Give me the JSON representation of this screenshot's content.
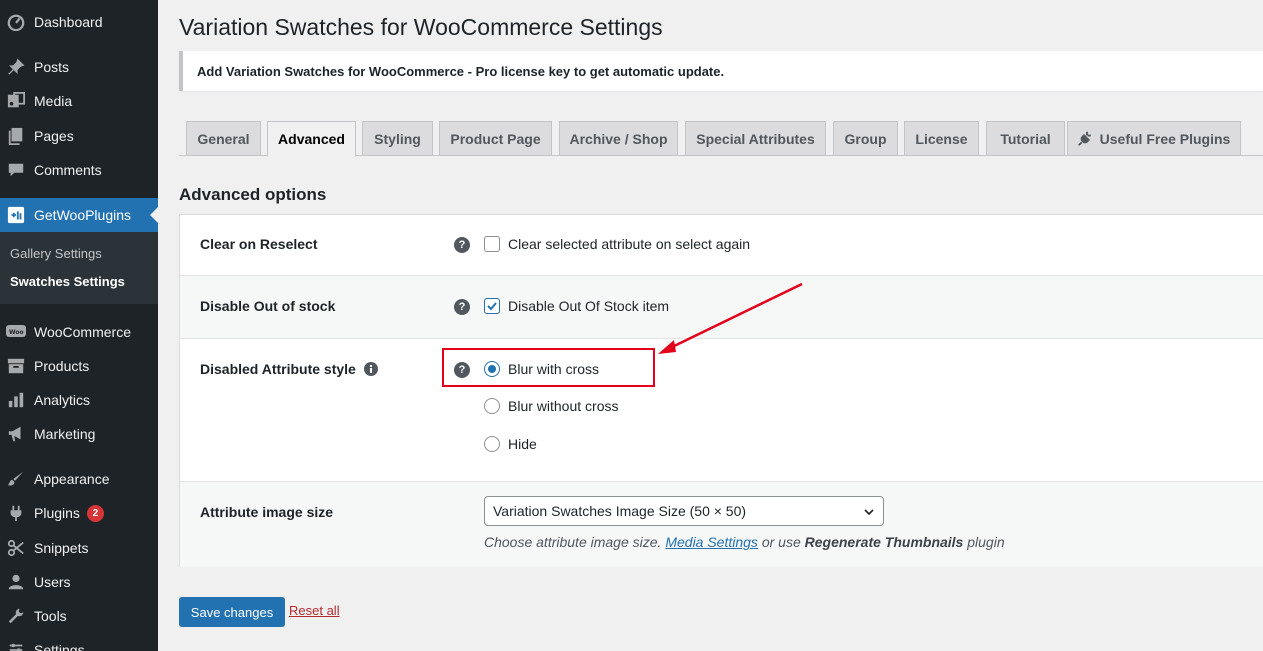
{
  "sidebar": {
    "items": [
      {
        "label": "Dashboard",
        "icon": "dashboard-icon"
      },
      {
        "label": "Posts",
        "icon": "pin-icon"
      },
      {
        "label": "Media",
        "icon": "media-icon"
      },
      {
        "label": "Pages",
        "icon": "pages-icon"
      },
      {
        "label": "Comments",
        "icon": "comment-icon"
      },
      {
        "label": "GetWooPlugins",
        "icon": "getwooplugins-icon"
      },
      {
        "label": "WooCommerce",
        "icon": "woocommerce-icon"
      },
      {
        "label": "Products",
        "icon": "archive-icon"
      },
      {
        "label": "Analytics",
        "icon": "bar-chart-icon"
      },
      {
        "label": "Marketing",
        "icon": "megaphone-icon"
      },
      {
        "label": "Appearance",
        "icon": "brush-icon"
      },
      {
        "label": "Plugins",
        "icon": "plug-icon",
        "badge": "2"
      },
      {
        "label": "Snippets",
        "icon": "scissors-icon"
      },
      {
        "label": "Users",
        "icon": "user-icon"
      },
      {
        "label": "Tools",
        "icon": "wrench-icon"
      },
      {
        "label": "Settings",
        "icon": "settings-icon"
      }
    ],
    "submenu": [
      {
        "label": "Gallery Settings"
      },
      {
        "label": "Swatches Settings"
      }
    ]
  },
  "page": {
    "title": "Variation Swatches for WooCommerce Settings",
    "notice": "Add Variation Swatches for WooCommerce - Pro license key to get automatic update.",
    "tabs": [
      {
        "label": "General"
      },
      {
        "label": "Advanced"
      },
      {
        "label": "Styling"
      },
      {
        "label": "Product Page"
      },
      {
        "label": "Archive / Shop"
      },
      {
        "label": "Special Attributes"
      },
      {
        "label": "Group"
      },
      {
        "label": "License"
      },
      {
        "label": "Tutorial"
      },
      {
        "label": "Useful Free Plugins"
      }
    ],
    "active_tab": "Advanced",
    "section_title": "Advanced options"
  },
  "options": {
    "clear_on_reselect": {
      "label": "Clear on Reselect",
      "checkbox_label": "Clear selected attribute on select again",
      "checked": false
    },
    "disable_out_of_stock": {
      "label": "Disable Out of stock",
      "checkbox_label": "Disable Out Of Stock item",
      "checked": true
    },
    "disabled_attribute_style": {
      "label": "Disabled Attribute style",
      "options": [
        {
          "label": "Blur with cross",
          "checked": true
        },
        {
          "label": "Blur without cross",
          "checked": false
        },
        {
          "label": "Hide",
          "checked": false
        }
      ]
    },
    "attribute_image_size": {
      "label": "Attribute image size",
      "selected": "Variation Swatches Image Size (50 × 50)",
      "desc_prefix": "Choose attribute image size.",
      "desc_link": "Media Settings",
      "desc_middle": "or use",
      "desc_bold": "Regenerate Thumbnails",
      "desc_suffix": "plugin"
    }
  },
  "actions": {
    "save": "Save changes",
    "reset": "Reset all"
  },
  "colors": {
    "sidebar_bg": "#1d2327",
    "accent": "#2271b1",
    "annotation": "#e3001b"
  }
}
